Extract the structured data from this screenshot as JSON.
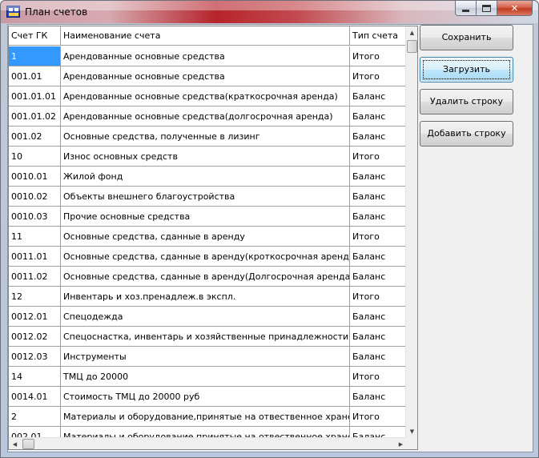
{
  "window": {
    "title": "План счетов",
    "close_glyph": "✕"
  },
  "table": {
    "columns": [
      "Счет ГК",
      "Наименование счета",
      "Тип счета"
    ],
    "rows": [
      {
        "account": "1",
        "name": "Арендованные основные средства",
        "type": "Итого"
      },
      {
        "account": "001.01",
        "name": "Арендованные основные средства",
        "type": "Итого"
      },
      {
        "account": "001.01.01",
        "name": "Арендованные основные средства(краткосрочная аренда)",
        "type": "Баланс"
      },
      {
        "account": "001.01.02",
        "name": "Арендованные основные средства(долгосрочная аренда)",
        "type": "Баланс"
      },
      {
        "account": "001.02",
        "name": "Основные средства, полученные в лизинг",
        "type": "Баланс"
      },
      {
        "account": "10",
        "name": "Износ основных средств",
        "type": "Итого"
      },
      {
        "account": "0010.01",
        "name": "Жилой фонд",
        "type": "Баланс"
      },
      {
        "account": "0010.02",
        "name": "Объекты внешнего благоустройства",
        "type": "Баланс"
      },
      {
        "account": "0010.03",
        "name": "Прочие основные средства",
        "type": "Баланс"
      },
      {
        "account": "11",
        "name": "Основные средства, сданные в аренду",
        "type": "Итого"
      },
      {
        "account": "0011.01",
        "name": "Основные средства, сданные в аренду(кроткосрочная аренда)",
        "type": "Баланс"
      },
      {
        "account": "0011.02",
        "name": "Основные средства, сданные в аренду(Долгосрочная аренда)",
        "type": "Баланс"
      },
      {
        "account": "12",
        "name": "Инвентарь и хоз.пренадлеж.в экспл.",
        "type": "Итого"
      },
      {
        "account": "0012.01",
        "name": "Спецодежда",
        "type": "Баланс"
      },
      {
        "account": "0012.02",
        "name": "Спецоснастка, инвентарь и хозяйственные принадлежности",
        "type": "Баланс"
      },
      {
        "account": "0012.03",
        "name": "Инструменты",
        "type": "Баланс"
      },
      {
        "account": "14",
        "name": "ТМЦ до 20000",
        "type": "Итого"
      },
      {
        "account": "0014.01",
        "name": "Стоимость ТМЦ до 20000 руб",
        "type": "Баланс"
      },
      {
        "account": "2",
        "name": "Материалы и оборудование,принятые на отвественное хранение",
        "type": "Итого"
      },
      {
        "account": "002.01",
        "name": "Материалы и оборудование,принятые на отвественное хранение",
        "type": "Баланс"
      }
    ],
    "selected_row": 0
  },
  "buttons": {
    "save": "Сохранить",
    "load": "Загрузить",
    "delete_row": "Удалить строку",
    "add_row": "Добавить строку"
  }
}
